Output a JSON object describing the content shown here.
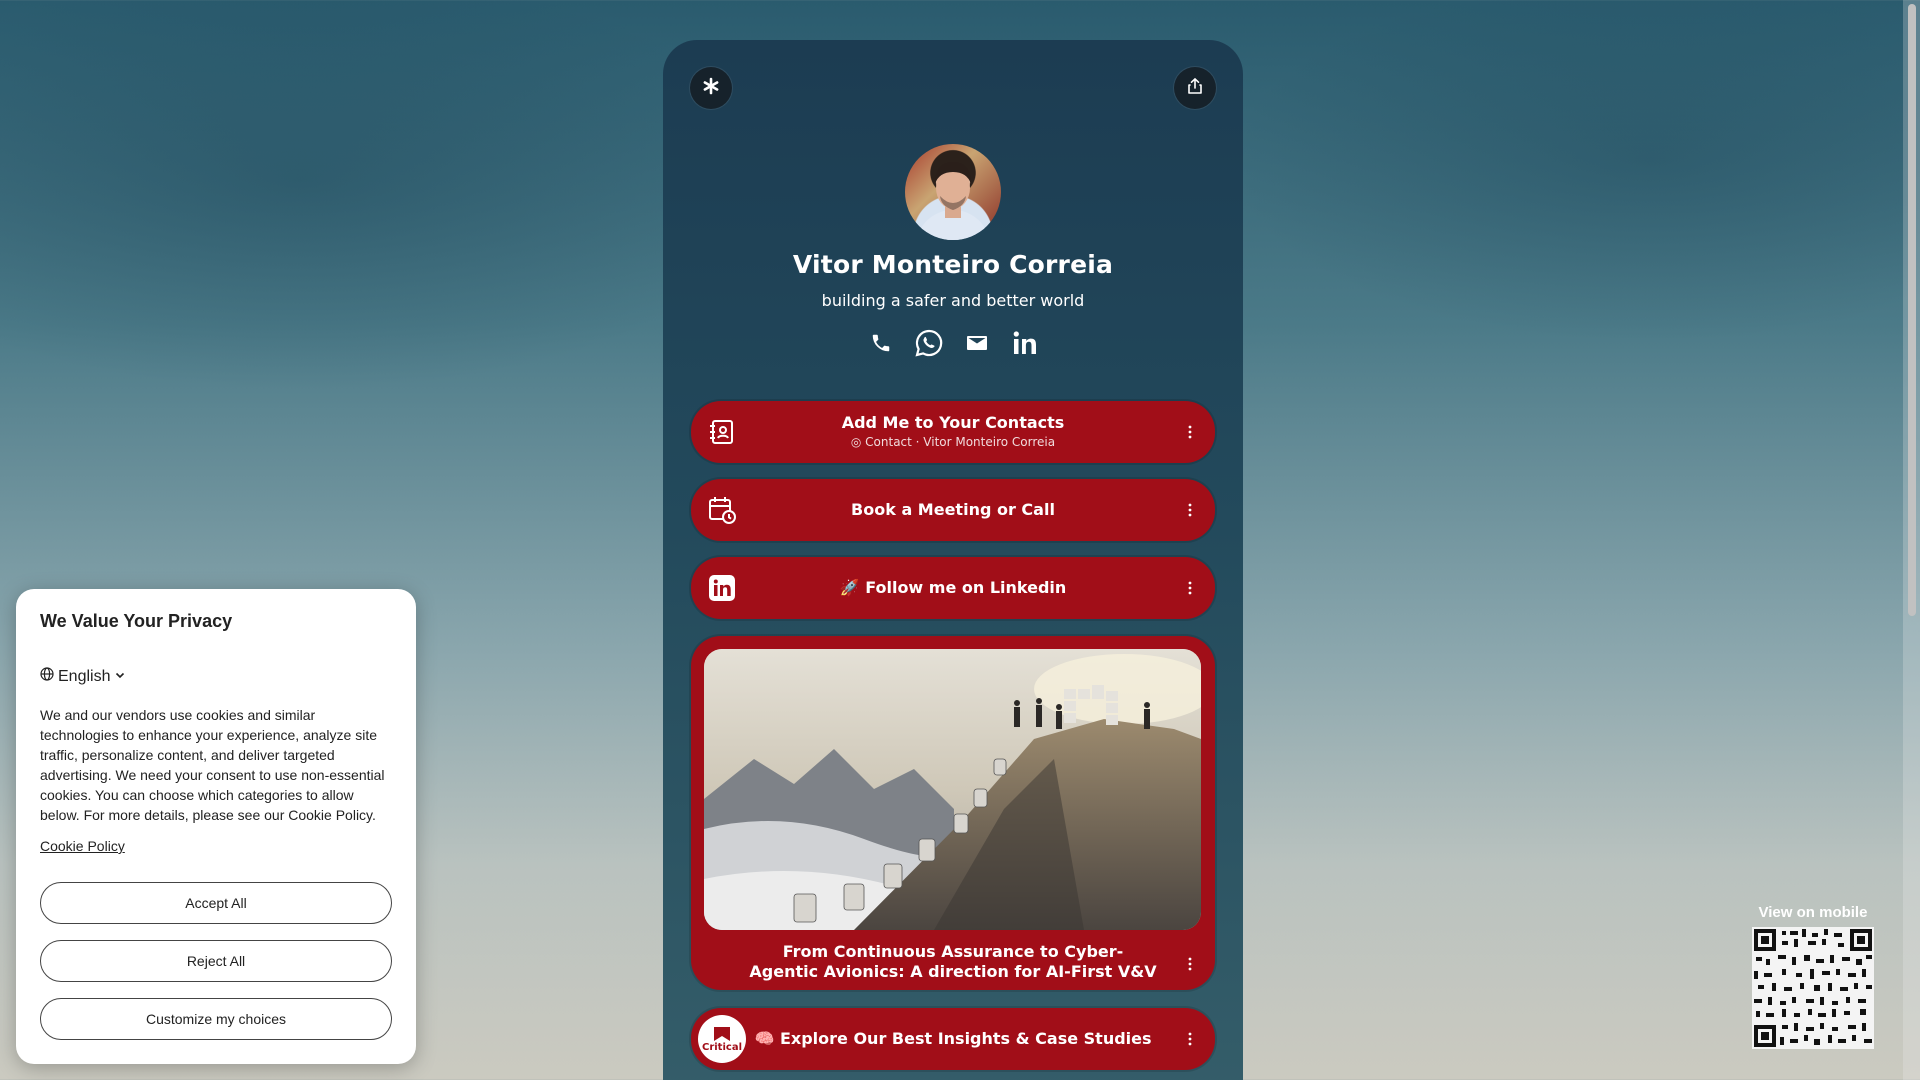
{
  "profile": {
    "name": "Vitor Monteiro Correia",
    "tagline": "building a safer and better world"
  },
  "socials": [
    "phone-icon",
    "whatsapp-icon",
    "email-icon",
    "linkedin-icon"
  ],
  "links": {
    "contacts": {
      "title": "Add Me to Your Contacts",
      "subtitle": "◎ Contact · Vitor Monteiro Correia"
    },
    "meeting": {
      "title": "Book a Meeting or Call"
    },
    "linkedin": {
      "title": "🚀 Follow me on Linkedin"
    },
    "feature": {
      "title_line1": "From Continuous Assurance to Cyber-",
      "title_line2": "Agentic Avionics: A direction for AI-First V&V"
    },
    "insights": {
      "title": "🧠 Explore Our Best Insights & Case Studies",
      "logo_text": "Critical"
    }
  },
  "privacy": {
    "title": "We Value Your Privacy",
    "language": "English",
    "body": "We and our vendors use cookies and similar technologies to enhance your experience, analyze site traffic, personalize content, and deliver targeted advertising. We need your consent to use non-essential cookies. You can choose which categories to allow below. For more details, please see our Cookie Policy.",
    "cookie_link": "Cookie Policy",
    "accept": "Accept All",
    "reject": "Reject All",
    "customize": "Customize my choices"
  },
  "qr": {
    "label": "View on mobile"
  },
  "colors": {
    "button_red": "#a10e18",
    "card_bg": "#1c3c52"
  }
}
